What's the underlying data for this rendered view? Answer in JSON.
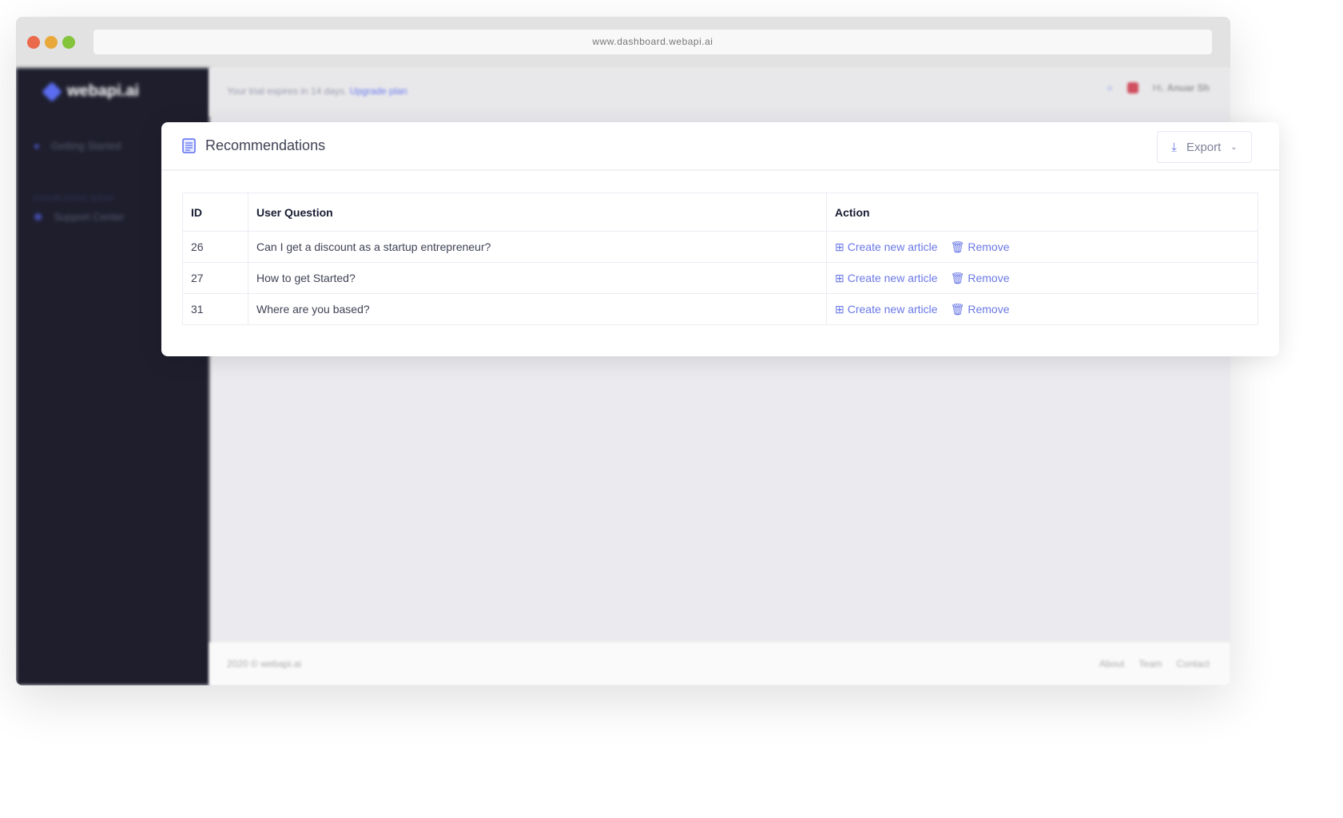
{
  "browser": {
    "url": "www.dashboard.webapi.ai"
  },
  "sidebar": {
    "brand": "webapi.ai",
    "items": [
      {
        "label": "Getting Started"
      },
      {
        "label": "Support Center"
      }
    ],
    "section": "KNOWLEDGE BASE"
  },
  "header": {
    "trial_text": "Your trial expires in 14 days.",
    "upgrade_link": "Upgrade plan",
    "greeting": "Hi,",
    "user": "Anuar Sh"
  },
  "card": {
    "title": "Recommendations",
    "export_label": "Export"
  },
  "table": {
    "columns": [
      "ID",
      "User Question",
      "Action"
    ],
    "rows": [
      {
        "id": "26",
        "question": "Can I get a discount as a startup entrepreneur?"
      },
      {
        "id": "27",
        "question": "How to get Started?"
      },
      {
        "id": "31",
        "question": "Where are you based?"
      }
    ],
    "create_label": "Create new article",
    "remove_label": "Remove"
  },
  "footer": {
    "copyright": "2020 © webapi.ai",
    "links": [
      "About",
      "Team",
      "Contact"
    ]
  },
  "colors": {
    "accent": "#6a78e6",
    "sidebar": "#1e1e2d"
  }
}
